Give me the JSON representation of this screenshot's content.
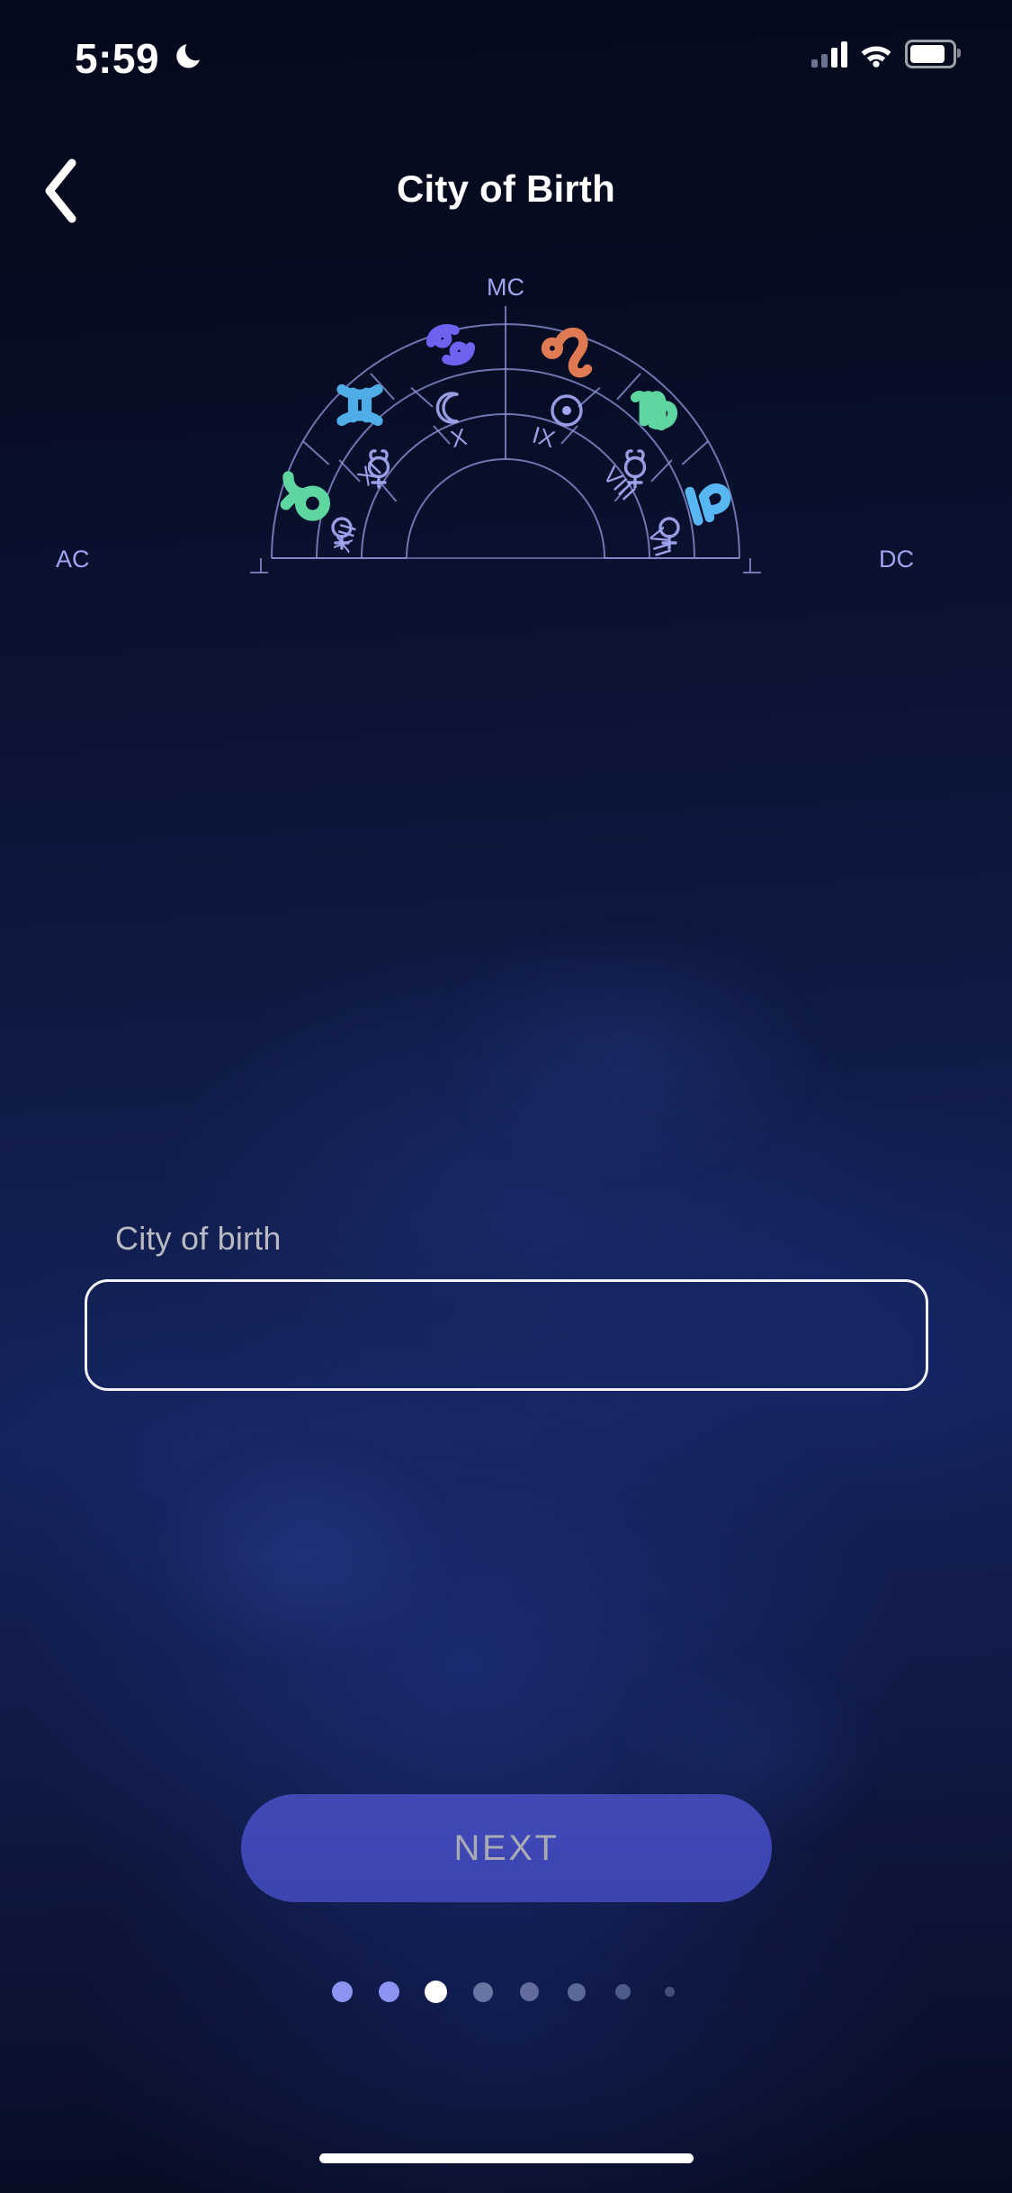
{
  "status_bar": {
    "time": "5:59",
    "dnd_icon": "crescent-moon-icon",
    "signal_icon": "cellular-signal-icon",
    "signal_bars_filled": 2,
    "wifi_icon": "wifi-icon",
    "battery_icon": "battery-icon",
    "battery_level_pct": 74
  },
  "header": {
    "back_icon": "chevron-left-icon",
    "title": "City of Birth"
  },
  "chart": {
    "type": "astrology-natal-wheel-half",
    "axis_labels": {
      "left": "AC",
      "top": "MC",
      "right": "DC"
    },
    "zodiac_signs": [
      {
        "name": "taurus",
        "glyph": "♉",
        "color": "#5ED6A0",
        "angle_deg": 163
      },
      {
        "name": "gemini",
        "glyph": "♊",
        "color": "#4FAEE8",
        "angle_deg": 134
      },
      {
        "name": "cancer",
        "glyph": "♋",
        "color": "#6C63F0",
        "angle_deg": 105
      },
      {
        "name": "leo",
        "glyph": "♌",
        "color": "#E07A52",
        "angle_deg": 73
      },
      {
        "name": "virgo",
        "glyph": "♍",
        "color": "#5ED6A0",
        "angle_deg": 44
      },
      {
        "name": "libra",
        "glyph": "♎",
        "color": "#58B6F2",
        "angle_deg": 16
      }
    ],
    "planets": [
      {
        "name": "venus",
        "glyph": "♀",
        "angle_deg": 170
      },
      {
        "name": "mercury",
        "glyph": "☿",
        "angle_deg": 140
      },
      {
        "name": "moon",
        "glyph": "☾",
        "angle_deg": 107
      },
      {
        "name": "sun",
        "glyph": "☉",
        "angle_deg": 74
      },
      {
        "name": "mercury",
        "glyph": "☿",
        "angle_deg": 41
      },
      {
        "name": "venus",
        "glyph": "♀",
        "angle_deg": 12
      }
    ],
    "houses": [
      {
        "numeral": "XII",
        "angle_deg": 166
      },
      {
        "numeral": "XI",
        "angle_deg": 139
      },
      {
        "numeral": "X",
        "angle_deg": 110
      },
      {
        "numeral": "IX",
        "angle_deg": 72
      },
      {
        "numeral": "VIII",
        "angle_deg": 43
      },
      {
        "numeral": "VII",
        "angle_deg": 15
      }
    ],
    "line_color": "#8C93D6",
    "label_color": "#9FA6F0"
  },
  "form": {
    "label": "City of birth",
    "value": "",
    "placeholder": ""
  },
  "next_button": {
    "label": "NEXT",
    "bg_color": "#3F47B6",
    "text_color": "#A8AAB4",
    "enabled": false
  },
  "pagination": {
    "total": 8,
    "active_index": 2,
    "active_color": "#FFFFFF",
    "dots": [
      {
        "size": 23,
        "color": "#8C93F0",
        "opacity": 1.0
      },
      {
        "size": 23,
        "color": "#8C93F0",
        "opacity": 1.0
      },
      {
        "size": 25,
        "color": "#FFFFFF",
        "opacity": 1.0
      },
      {
        "size": 22,
        "color": "#6E7AA8",
        "opacity": 0.95
      },
      {
        "size": 21,
        "color": "#6A76A4",
        "opacity": 0.9
      },
      {
        "size": 20,
        "color": "#6A76A4",
        "opacity": 0.85
      },
      {
        "size": 17,
        "color": "#5E6A98",
        "opacity": 0.8
      },
      {
        "size": 11,
        "color": "#56628E",
        "opacity": 0.75
      }
    ]
  },
  "home_indicator": "home-indicator"
}
